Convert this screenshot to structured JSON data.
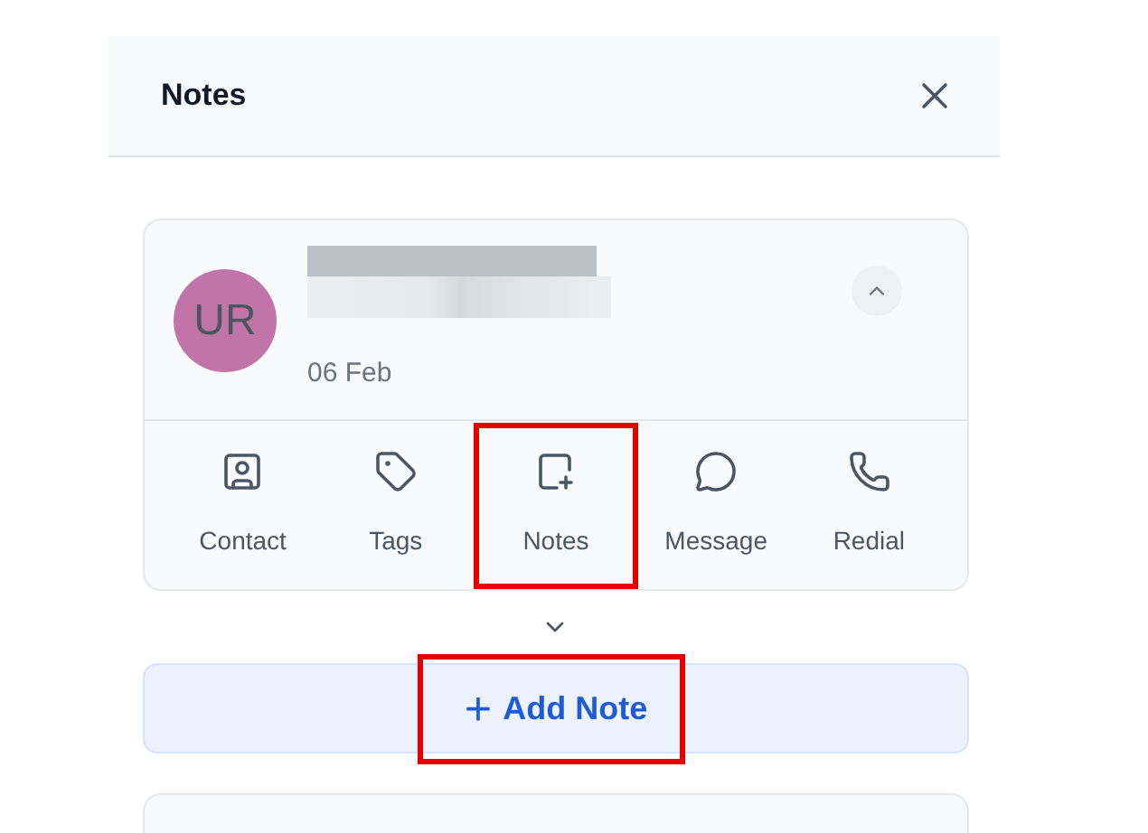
{
  "panel": {
    "title": "Notes"
  },
  "call_card": {
    "avatar": {
      "initials": "UR",
      "color": "#c074a8"
    },
    "date": "06 Feb",
    "name_redacted": true,
    "actions": [
      {
        "kind": "contact",
        "label": "Contact",
        "highlighted": false
      },
      {
        "kind": "tags",
        "label": "Tags",
        "highlighted": false
      },
      {
        "kind": "notes",
        "label": "Notes",
        "highlighted": true
      },
      {
        "kind": "message",
        "label": "Message",
        "highlighted": false
      },
      {
        "kind": "redial",
        "label": "Redial",
        "highlighted": false
      }
    ]
  },
  "add_note": {
    "icon": "+",
    "label": "Add Note",
    "highlighted": true
  }
}
